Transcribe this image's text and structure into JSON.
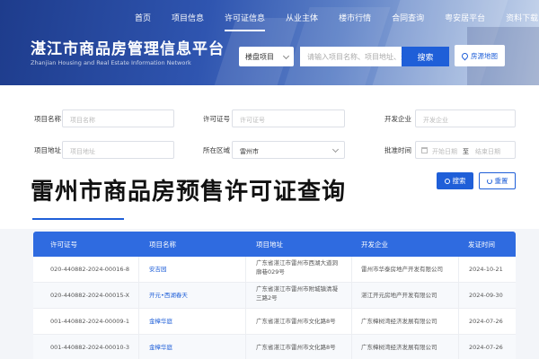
{
  "nav": {
    "items": [
      "首页",
      "项目信息",
      "许可证信息",
      "从业主体",
      "楼市行情",
      "合同查询",
      "粤安居平台",
      "资料下载"
    ],
    "active_index": 2
  },
  "brand": {
    "title": "湛江市商品房管理信息平台",
    "subtitle": "Zhanjian Housing and Real Estate Information Network"
  },
  "search": {
    "category": "楼盘项目",
    "placeholder": "请输入项目名称、项目地址、开",
    "button": "搜索",
    "map_button": "房源地图"
  },
  "filters": {
    "project_name": {
      "label": "项目名称",
      "placeholder": "项目名称"
    },
    "license_no": {
      "label": "许可证号",
      "placeholder": "许可证号"
    },
    "developer": {
      "label": "开发企业",
      "placeholder": "开发企业"
    },
    "project_address": {
      "label": "项目地址",
      "placeholder": "项目地址"
    },
    "region": {
      "label": "所在区域",
      "value": "雷州市"
    },
    "approval_time": {
      "label": "批准时间",
      "start": "开始日期",
      "to": "至",
      "end": "结束日期"
    },
    "query_button": "搜索",
    "reset_button": "重置"
  },
  "page_heading": "雷州市商品房预售许可证查询",
  "table": {
    "headers": [
      "许可证号",
      "项目名称",
      "项目地址",
      "开发企业",
      "发证时间"
    ],
    "rows": [
      {
        "license": "020-440882-2024-00016-8",
        "project": "安吉园",
        "address": "广东省湛江市雷州市西湖大道洞廓巷029号",
        "developer": "雷州市华泰房地产开发有限公司",
        "date": "2024-10-21"
      },
      {
        "license": "020-440882-2024-00015-X",
        "project": "开元•西湖春天",
        "address": "广东省湛江市雷州市附城镇清凝三路2号",
        "developer": "湛江开元房地产开发有限公司",
        "date": "2024-09-30"
      },
      {
        "license": "001-440882-2024-00009-1",
        "project": "金樟华庭",
        "address": "广东省湛江市雷州市文化路8号",
        "developer": "广东樟树湾经济发展有限公司",
        "date": "2024-07-26"
      },
      {
        "license": "001-440882-2024-00010-3",
        "project": "金樟华庭",
        "address": "广东省湛江市雷州市文化路8号",
        "developer": "广东樟树湾经济发展有限公司",
        "date": "2024-07-26"
      }
    ]
  },
  "colors": {
    "accent": "#1f5fd8",
    "table_header": "#2f6be0",
    "banner": "#2f55b0"
  }
}
